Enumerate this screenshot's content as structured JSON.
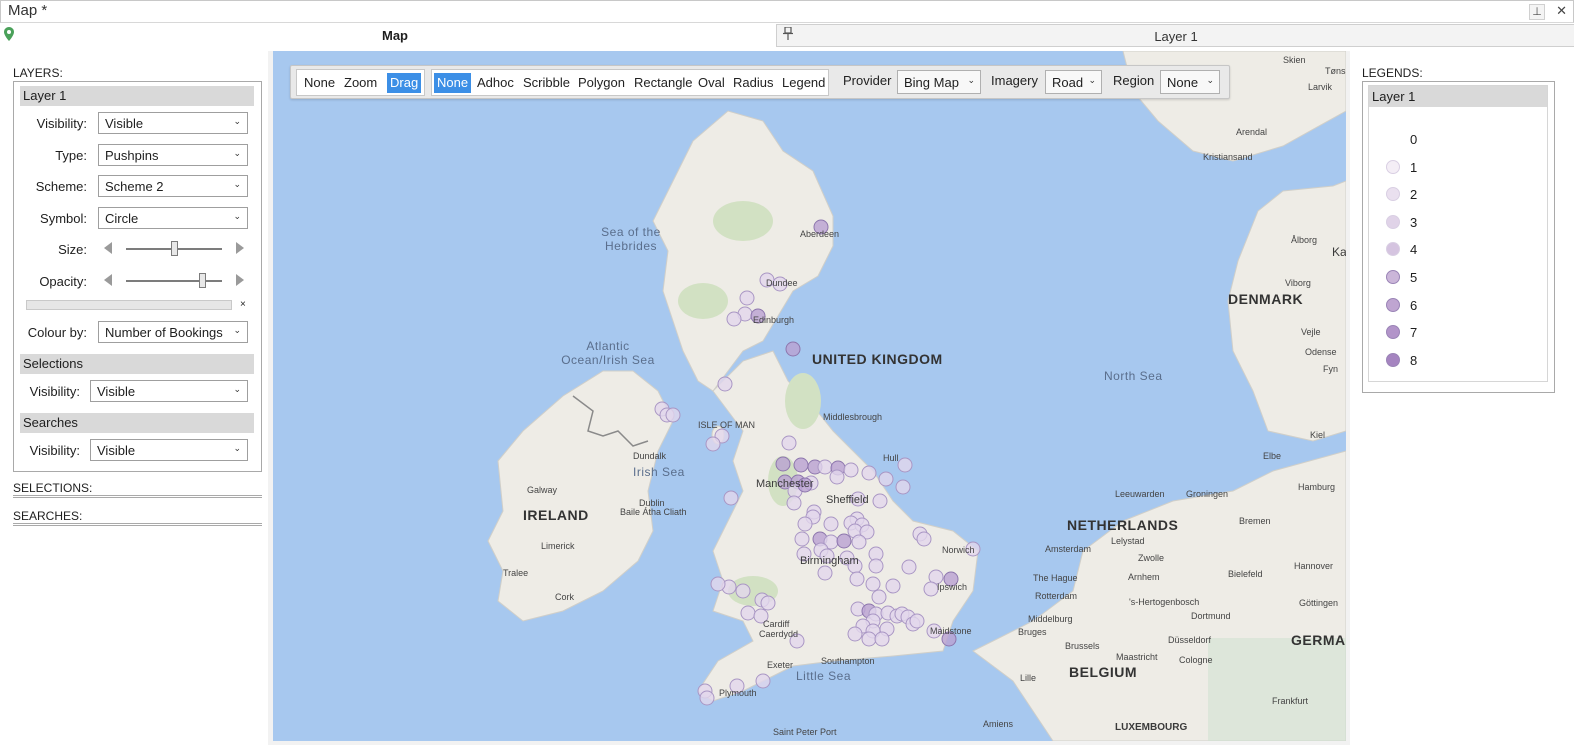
{
  "window": {
    "title": "Map *"
  },
  "tabs": [
    {
      "label": "Map"
    },
    {
      "label": "Layer 1"
    }
  ],
  "left_panel": {
    "layers_title": "LAYERS:",
    "layer": {
      "name": "Layer 1",
      "visibility_label": "Visibility:",
      "visibility_value": "Visible",
      "type_label": "Type:",
      "type_value": "Pushpins",
      "scheme_label": "Scheme:",
      "scheme_value": "Scheme 2",
      "symbol_label": "Symbol:",
      "symbol_value": "Circle",
      "size_label": "Size:",
      "size_level": 0.5,
      "opacity_label": "Opacity:",
      "opacity_level": 0.82,
      "clear_mark": "×",
      "colour_by_label": "Colour by:",
      "colour_by_value": "Number of Bookings"
    },
    "selections_group": {
      "header": "Selections",
      "visibility_label": "Visibility:",
      "visibility_value": "Visible"
    },
    "searches_group": {
      "header": "Searches",
      "visibility_label": "Visibility:",
      "visibility_value": "Visible"
    },
    "selections_title": "SELECTIONS:",
    "searches_title": "SEARCHES:"
  },
  "toolbar": {
    "nav_buttons": [
      "None",
      "Zoom",
      "Drag"
    ],
    "nav_active": "Drag",
    "draw_buttons": [
      "None",
      "Adhoc",
      "Scribble",
      "Polygon",
      "Rectangle",
      "Oval",
      "Radius",
      "Legend"
    ],
    "draw_active": "None",
    "provider_label": "Provider",
    "provider_value": "Bing Map",
    "imagery_label": "Imagery",
    "imagery_value": "Road",
    "region_label": "Region",
    "region_value": "None"
  },
  "map": {
    "labels": {
      "uk": "UNITED KINGDOM",
      "ireland": "IRELAND",
      "denmark": "DENMARK",
      "netherlands": "NETHERLANDS",
      "belgium": "BELGIUM",
      "germany": "GERMAN",
      "luxembourg": "LUXEMBOURG",
      "north_sea": "North Sea",
      "irish_sea": "Irish Sea",
      "little_sea": "Little Sea",
      "hebrides": "Sea of the Hebrides",
      "atlantic": "Atlantic Ocean/Irish Sea",
      "isle_of_man": "ISLE OF MAN",
      "aberdeen": "Aberdeen",
      "dundee": "Dundee",
      "edinburgh": "Edinburgh",
      "middlesbrough": "Middlesbrough",
      "hull": "Hull",
      "sheffield": "Sheffield",
      "manchester": "Manchester",
      "birmingham": "Birmingham",
      "norwich": "Norwich",
      "ipswich": "Ipswich",
      "cardiff": "Cardiff",
      "caerdydd": "Caerdydd",
      "maidstone": "Maidstone",
      "southampton": "Southampton",
      "exeter": "Exeter",
      "plymouth": "Plymouth",
      "saint_peter_port": "Saint Peter Port",
      "dublin": "Dublin",
      "baile_atha_cliath": "Baile Átha Cliath",
      "dundalk": "Dundalk",
      "galway": "Galway",
      "limerick": "Limerick",
      "cork": "Cork",
      "tralee": "Tralee",
      "amsterdam": "Amsterdam",
      "the_hague": "The Hague",
      "rotterdam": "Rotterdam",
      "arnhem": "Arnhem",
      "zwolle": "Zwolle",
      "lelystad": "Lelystad",
      "groningen": "Groningen",
      "leeuwarden": "Leeuwarden",
      "bremen": "Bremen",
      "hamburg": "Hamburg",
      "hannover": "Hannover",
      "bielefeld": "Bielefeld",
      "dortmund": "Dortmund",
      "dusseldorf": "Düsseldorf",
      "cologne": "Cologne",
      "gottingen": "Göttingen",
      "brussels": "Brussels",
      "bruges": "Bruges",
      "maastricht": "Maastricht",
      "lille": "Lille",
      "amiens": "Amiens",
      "middelburg": "Middelburg",
      "hertogenbosch": "'s-Hertogenbosch",
      "frankfurt": "Frankfurt",
      "kiel": "Kiel",
      "elbe": "Elbe",
      "aalborg": "Ålborg",
      "viborg": "Viborg",
      "vejle": "Vejle",
      "odense": "Odense",
      "fyn": "Fyn",
      "arendal": "Arendal",
      "kristiansand": "Kristiansand",
      "skien": "Skien",
      "larvik": "Larvik",
      "tonsberg": "Tøns",
      "ka": "Ka"
    }
  },
  "legend_panel": {
    "title": "LEGENDS:",
    "layer_name": "Layer 1",
    "items": [
      "0",
      "1",
      "2",
      "3",
      "4",
      "5",
      "6",
      "7",
      "8"
    ],
    "colors": [
      "#ffffff",
      "#f4eef6",
      "#eae0ef",
      "#e0d3e8",
      "#d5c4e0",
      "#cbb6d9",
      "#bfa5d1",
      "#b294c9",
      "#a584c0"
    ]
  },
  "colors": {
    "sea": "#a7c8ef",
    "land": "#eeece6",
    "accent_blue": "#3c8fe6",
    "pin_fill": "#c8b6dc",
    "pin_stroke": "#9c86b8"
  }
}
